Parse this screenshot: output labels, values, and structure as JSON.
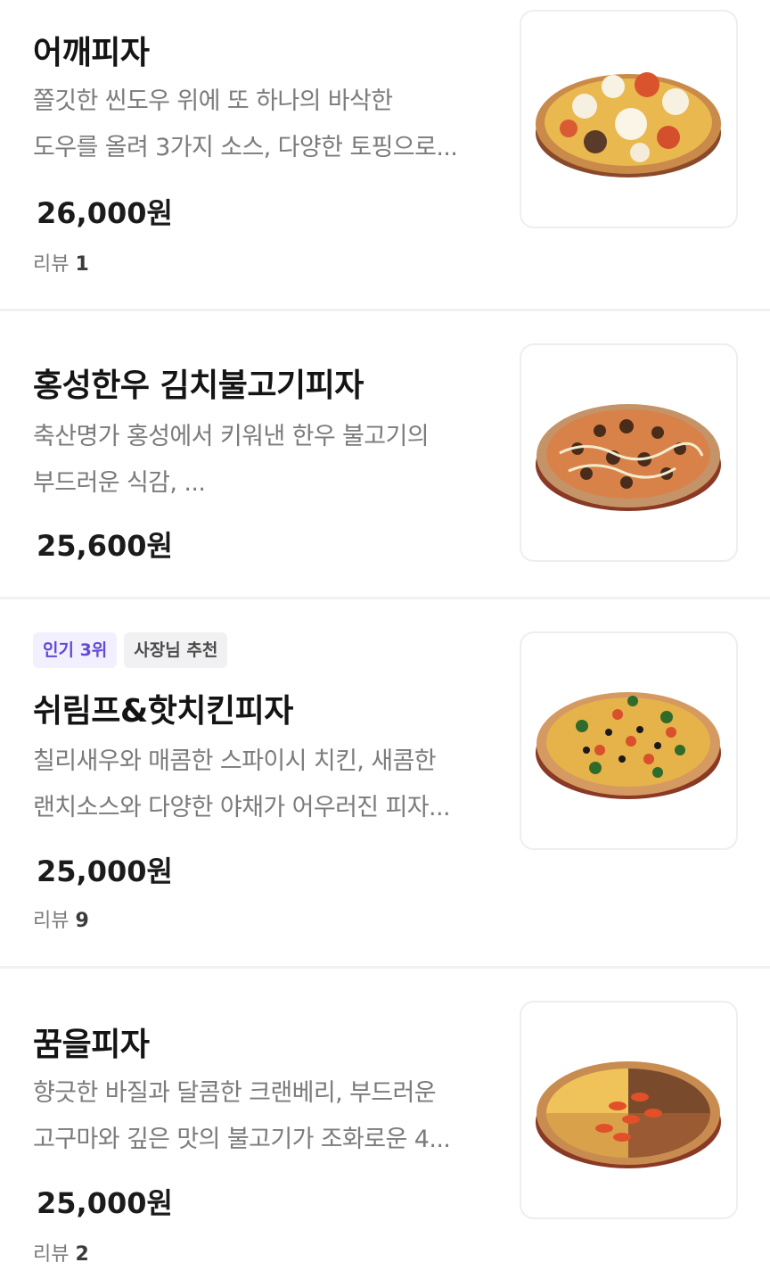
{
  "menu_items": [
    {
      "name": "어깨피자",
      "desc_lines": [
        "쫄깃한 씬도우 위에 또 하나의 바삭한",
        "도우를 올려 3가지 소스, 다양한 토핑으로..."
      ],
      "price": "26,000원",
      "review_label": "리뷰",
      "review_count": "1",
      "image_icon": "pizza-image"
    },
    {
      "name": "홍성한우 김치불고기피자",
      "desc_lines": [
        "축산명가 홍성에서 키워낸 한우 불고기의",
        "부드러운 식감, ..."
      ],
      "price": "25,600원",
      "image_icon": "pizza-image"
    },
    {
      "badges": [
        "인기 3위",
        "사장님 추천"
      ],
      "name": "쉬림프&핫치킨피자",
      "desc_lines": [
        "칠리새우와 매콤한 스파이시 치킨, 새콤한",
        "랜치소스와 다양한 야채가 어우러진 피자..."
      ],
      "price": "25,000원",
      "review_label": "리뷰",
      "review_count": "9",
      "image_icon": "pizza-image"
    },
    {
      "name": "꿈을피자",
      "desc_lines": [
        "향긋한 바질과 달콤한 크랜베리, 부드러운",
        "고구마와 깊은 맛의 불고기가 조화로운 4..."
      ],
      "price": "25,000원",
      "review_label": "리뷰",
      "review_count": "2",
      "image_icon": "pizza-image"
    }
  ],
  "colors": {
    "badge_rank_bg": "#f2efff",
    "badge_rank_text": "#6448d8",
    "badge_owner_bg": "#f1f1f3",
    "divider": "#f1f1f3"
  }
}
